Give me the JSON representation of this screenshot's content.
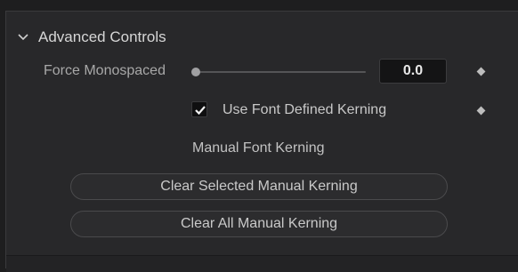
{
  "section": {
    "title": "Advanced Controls",
    "expanded": true
  },
  "force_monospaced": {
    "label": "Force Monospaced",
    "value": "0.0",
    "slider_level": 0.0
  },
  "use_font_kerning": {
    "label": "Use Font Defined Kerning",
    "checked": true
  },
  "manual_kerning": {
    "label": "Manual Font Kerning",
    "clear_selected_label": "Clear Selected Manual Kerning",
    "clear_all_label": "Clear All Manual Kerning"
  },
  "icons": {
    "section_toggle": "chevron-down-icon",
    "keyframe": "diamond-icon",
    "check": "checkmark-icon"
  },
  "colors": {
    "panel_bg": "#28282a",
    "field_bg": "#141415",
    "text": "#d6d6d6",
    "label_text": "#a8a8a8"
  }
}
